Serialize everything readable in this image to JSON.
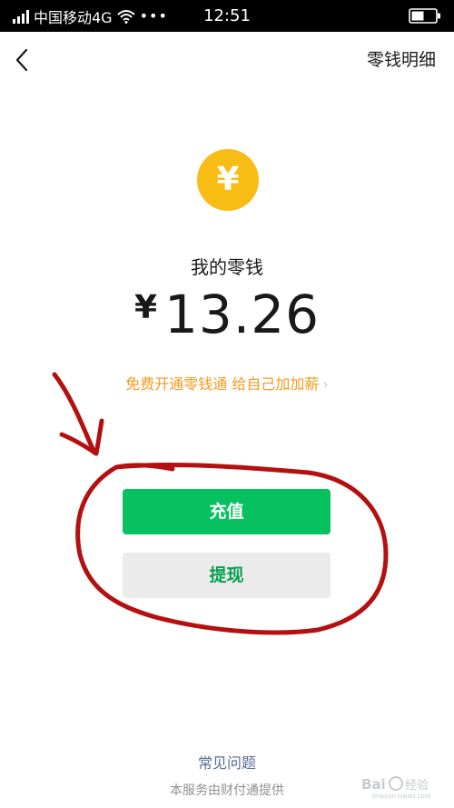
{
  "status_bar": {
    "carrier": "中国移动4G",
    "more": "•••",
    "time": "12:51",
    "icons": [
      "signal-icon",
      "wifi-icon",
      "battery-icon"
    ]
  },
  "nav": {
    "title": "零钱明细",
    "back_icon": "chevron-left-icon"
  },
  "wallet": {
    "coin_symbol": "¥",
    "label": "我的零钱",
    "currency": "¥",
    "amount": "13.26",
    "promo": "免费开通零钱通 给自己加加薪",
    "promo_chevron": "›"
  },
  "actions": {
    "topup_label": "充值",
    "withdraw_label": "提现"
  },
  "footer": {
    "faq": "常见问题",
    "provider": "本服务由财付通提供"
  },
  "watermark": {
    "text": "Bai du 经验",
    "url": "jingyan.baidu.com"
  },
  "colors": {
    "status_bar_bg": "#000000",
    "coin": "#f8bd14",
    "promo": "#f59a23",
    "primary_button": "#07c160",
    "secondary_button": "#ebebeb",
    "secondary_text": "#07a152",
    "link": "#576b95",
    "annotation": "#b51010"
  }
}
